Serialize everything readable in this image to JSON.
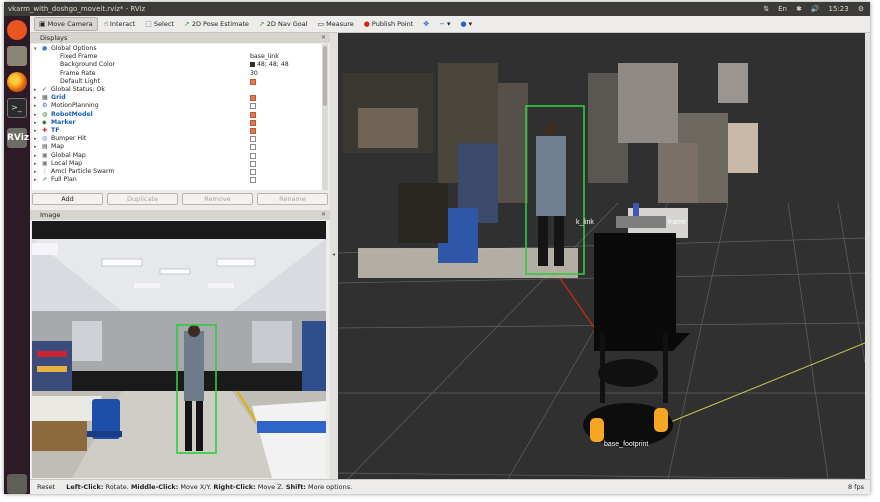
{
  "window": {
    "title": "vkarm_with_doshgo_moveit.rviz* - RViz",
    "tray": {
      "network": "⇅",
      "keyboard": "En",
      "bluetooth": "✱",
      "sound": "🔊",
      "clock": "15:23",
      "settings": "⚙"
    }
  },
  "toolbar": {
    "tools": [
      {
        "label": "Move Camera",
        "icon": "camera-icon",
        "active": true
      },
      {
        "label": "Interact",
        "icon": "hand-cursor-icon",
        "active": false
      },
      {
        "label": "Select",
        "icon": "select-box-icon",
        "active": false
      },
      {
        "label": "2D Pose Estimate",
        "icon": "pose-arrow-icon",
        "active": false
      },
      {
        "label": "2D Nav Goal",
        "icon": "goal-arrow-icon",
        "active": false
      },
      {
        "label": "Measure",
        "icon": "ruler-icon",
        "active": false
      },
      {
        "label": "Publish Point",
        "icon": "pin-icon",
        "active": false
      }
    ],
    "view_controls": [
      "✥",
      "−",
      "▾",
      "●",
      "▾"
    ]
  },
  "displays": {
    "title": "Displays",
    "rows": [
      {
        "name": "Global Options",
        "value": "",
        "indent": 0,
        "arrow": "▾",
        "icon": "globe-icon",
        "style": ""
      },
      {
        "name": "Fixed Frame",
        "value": "base_link",
        "indent": 2,
        "arrow": "",
        "icon": "",
        "style": ""
      },
      {
        "name": "Background Color",
        "value": "48; 48; 48",
        "indent": 2,
        "arrow": "",
        "icon": "",
        "style": "",
        "swatch": "#303030"
      },
      {
        "name": "Frame Rate",
        "value": "30",
        "indent": 2,
        "arrow": "",
        "icon": "",
        "style": ""
      },
      {
        "name": "Default Light",
        "value": "",
        "indent": 2,
        "arrow": "",
        "icon": "",
        "style": "",
        "checkbox": true
      },
      {
        "name": "Global Status: Ok",
        "value": "",
        "indent": 0,
        "arrow": "▸",
        "icon": "check-icon",
        "style": ""
      },
      {
        "name": "Grid",
        "value": "",
        "indent": 0,
        "arrow": "▸",
        "icon": "grid-icon",
        "style": "blue",
        "checkbox": true
      },
      {
        "name": "MotionPlanning",
        "value": "",
        "indent": 0,
        "arrow": "▸",
        "icon": "motion-planning-icon",
        "style": "",
        "checkbox": false
      },
      {
        "name": "RobotModel",
        "value": "",
        "indent": 0,
        "arrow": "▸",
        "icon": "robot-icon",
        "style": "blue",
        "checkbox": true
      },
      {
        "name": "Marker",
        "value": "",
        "indent": 0,
        "arrow": "▸",
        "icon": "marker-icon",
        "style": "blue",
        "checkbox": true
      },
      {
        "name": "TF",
        "value": "",
        "indent": 0,
        "arrow": "▸",
        "icon": "tf-icon",
        "style": "blue",
        "checkbox": true
      },
      {
        "name": "Bumper Hit",
        "value": "",
        "indent": 0,
        "arrow": "▸",
        "icon": "bumper-icon",
        "style": "",
        "checkbox": false
      },
      {
        "name": "Map",
        "value": "",
        "indent": 0,
        "arrow": "▸",
        "icon": "map-icon",
        "style": "",
        "checkbox": false
      },
      {
        "name": "Global Map",
        "value": "",
        "indent": 0,
        "arrow": "▸",
        "icon": "folder-icon",
        "style": "",
        "checkbox": false
      },
      {
        "name": "Local Map",
        "value": "",
        "indent": 0,
        "arrow": "▸",
        "icon": "folder-icon",
        "style": "",
        "checkbox": false
      },
      {
        "name": "Amcl Particle Swarm",
        "value": "",
        "indent": 0,
        "arrow": "▸",
        "icon": "particles-icon",
        "style": "",
        "checkbox": false
      },
      {
        "name": "Full Plan",
        "value": "",
        "indent": 0,
        "arrow": "▸",
        "icon": "path-icon",
        "style": "",
        "checkbox": false
      }
    ],
    "buttons": {
      "add": "Add",
      "duplicate": "Duplicate",
      "remove": "Remove",
      "rename": "Rename"
    }
  },
  "image_panel": {
    "title": "Image"
  },
  "view3d": {
    "labels": {
      "frame_top": "k_link",
      "frame_top_right": "frame",
      "base_frame": "base_footprint"
    }
  },
  "statusbar": {
    "reset": "Reset",
    "left_click": "Left-Click:",
    "left_click_desc": "Rotate.",
    "middle_click": "Middle-Click:",
    "middle_click_desc": "Move X/Y.",
    "right_click": "Right-Click:",
    "right_click_desc": "Move Z.",
    "shift": "Shift:",
    "shift_desc": "More options.",
    "fps": "8 fps"
  },
  "colors": {
    "accent": "#e95420",
    "checkbox_on": "#e8784a",
    "background": "#303030",
    "detection_box": "#2ecc40",
    "robot_wheel": "#f5a623"
  }
}
